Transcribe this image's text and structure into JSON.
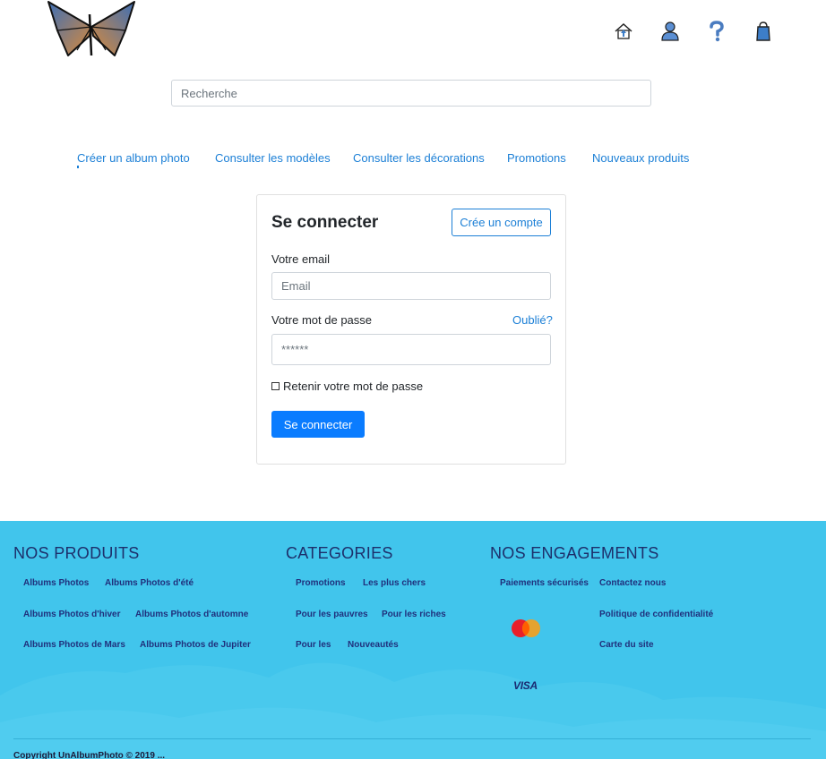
{
  "header": {
    "icons": [
      "home-icon",
      "user-icon",
      "help-icon",
      "shopping-bag-icon"
    ]
  },
  "search": {
    "placeholder": "Recherche"
  },
  "nav": [
    "Créer un album photo",
    "Consulter les modèles",
    "Consulter les décorations",
    "Promotions",
    "Nouveaux produits"
  ],
  "login": {
    "title": "Se connecter",
    "create_account": "Crée un compte",
    "email_label": "Votre email",
    "email_placeholder": "Email",
    "password_label": "Votre mot de passe",
    "forgot": "Oublié?",
    "password_placeholder": "******",
    "remember": "Retenir votre mot de passe",
    "submit": "Se connecter"
  },
  "footer": {
    "products_title": "NOS PRODUITS",
    "products": [
      "Albums Photos",
      "Albums Photos d'été",
      "Albums Photos d'hiver",
      "Albums Photos d'automne",
      "Albums Photos de Mars",
      "Albums Photos de Jupiter"
    ],
    "categories_title": "CATEGORIES",
    "categories": [
      "Promotions",
      "Les plus chers",
      "Pour les pauvres",
      "Pour les riches",
      "Pour les",
      "Nouveautés"
    ],
    "engagements_title": "NOS ENGAGEMENTS",
    "engagements": [
      "Paiements sécurisés",
      "Contactez nous",
      "Politique de confidentialité",
      "Carte du site"
    ],
    "payment_visa": "VISA",
    "copyright": "Copyright UnAlbumPhoto © 2019 ..."
  },
  "colors": {
    "link": "#1b7fd6",
    "primary": "#0a7cff",
    "footer_bg": "#41c5ec",
    "footer_heading": "#1d2f6b"
  }
}
